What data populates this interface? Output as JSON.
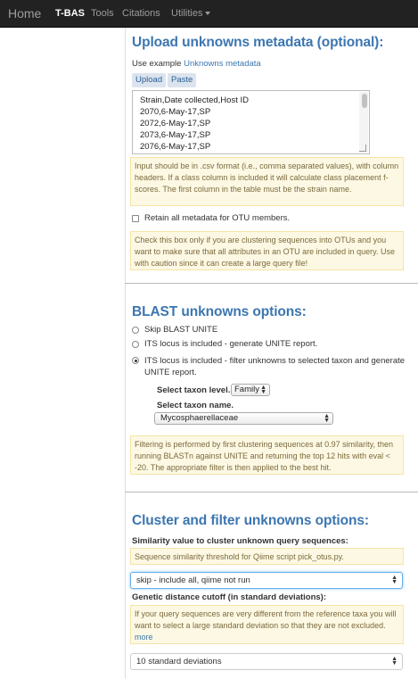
{
  "navbar": {
    "brand": "Home",
    "items": [
      "T-BAS",
      "Tools",
      "Citations",
      "Utilities"
    ]
  },
  "upload_section": {
    "title": "Upload unknowns metadata (optional):",
    "example_prefix": "Use example",
    "example_link": "Unknowns metadata",
    "upload_button": "Upload",
    "paste_button": "Paste",
    "textarea_lines": [
      "Strain,Date collected,Host ID",
      "2070,6-May-17,SP",
      "2072,6-May-17,SP",
      "2073,6-May-17,SP",
      "2076,6-May-17,SP"
    ],
    "format_note": "Input should be in .csv format (i.e., comma separated values), with column headers. If a class column is included it will calculate class placement f-scores. The first column in the table must be the strain name.",
    "retain_label": "Retain all metadata for OTU members.",
    "retain_note": "Check this box only if you are clustering sequences into OTUs and you want to make sure that all attributes in an OTU are included in query. Use with caution since it can create a large query file!"
  },
  "blast_section": {
    "title": "BLAST unknowns options:",
    "options": [
      "Skip BLAST UNITE",
      "ITS locus is included - generate UNITE report.",
      "ITS locus is included - filter unknowns to selected taxon and generate UNITE report."
    ],
    "selected_option": 2,
    "taxon_level_label": "Select taxon level.",
    "taxon_level_value": "Family",
    "taxon_name_label": "Select taxon name.",
    "taxon_name_value": "Mycosphaerellaceae",
    "filter_note": "Filtering is performed by first clustering sequences at 0.97 similarity, then running BLASTn against UNITE and returning the top 12 hits with eval < -20. The appropriate filter is then applied to the best hit."
  },
  "cluster_section": {
    "title": "Cluster and filter unknowns options:",
    "similarity_label": "Similarity value to cluster unknown query sequences:",
    "similarity_note": "Sequence similarity threshold for Qiime script pick_otus.py.",
    "similarity_value": "skip - include all, qiime not run",
    "distance_label": "Genetic distance cutoff (in standard deviations):",
    "distance_note": "If your query sequences are very different from the reference taxa you will want to select a large standard deviation so that they are not excluded.",
    "distance_more": "more",
    "distance_value": "10 standard deviations"
  }
}
